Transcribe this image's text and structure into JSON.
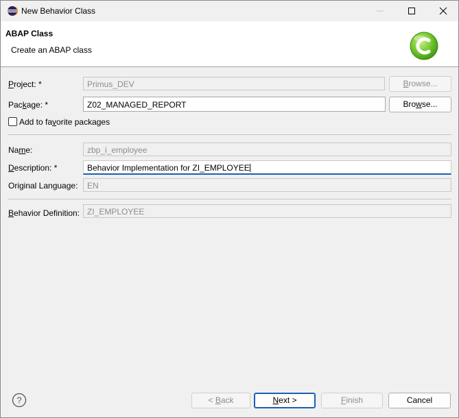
{
  "window": {
    "title": "New Behavior Class",
    "controls": {
      "minimize": "minimize",
      "maximize": "maximize",
      "close": "close"
    }
  },
  "banner": {
    "title": "ABAP Class",
    "subtitle": "Create an ABAP class",
    "logo_icon": "abap-class-logo-icon"
  },
  "form": {
    "project": {
      "label_pre": "",
      "label_mn": "P",
      "label_post": "roject: *",
      "value": "Primus_DEV",
      "browse": {
        "pre": "",
        "mn": "B",
        "post": "rowse..."
      }
    },
    "package": {
      "label_pre": "Pac",
      "label_mn": "k",
      "label_post": "age: *",
      "value": "Z02_MANAGED_REPORT",
      "browse": {
        "pre": "Bro",
        "mn": "w",
        "post": "se..."
      }
    },
    "favorite": {
      "pre": "Add to fa",
      "mn": "v",
      "post": "orite packages",
      "checked": false
    },
    "name": {
      "label_pre": "Na",
      "label_mn": "m",
      "label_post": "e:",
      "value": "zbp_i_employee"
    },
    "description": {
      "label_pre": "",
      "label_mn": "D",
      "label_post": "escription: *",
      "value": "Behavior Implementation for ZI_EMPLOYEE"
    },
    "original_language": {
      "label": "Original Language:",
      "value": "EN"
    },
    "behavior_definition": {
      "label_pre": "",
      "label_mn": "B",
      "label_post": "ehavior Definition:",
      "value": "ZI_EMPLOYEE"
    }
  },
  "footer": {
    "help_icon": "help-icon",
    "back": {
      "pre": "< ",
      "mn": "B",
      "post": "ack"
    },
    "next": {
      "pre": "",
      "mn": "N",
      "post": "ext >"
    },
    "finish": {
      "pre": "",
      "mn": "F",
      "post": "inish"
    },
    "cancel": "Cancel"
  },
  "colors": {
    "accent": "#1a5fb4",
    "logo": "#6cc22a"
  }
}
